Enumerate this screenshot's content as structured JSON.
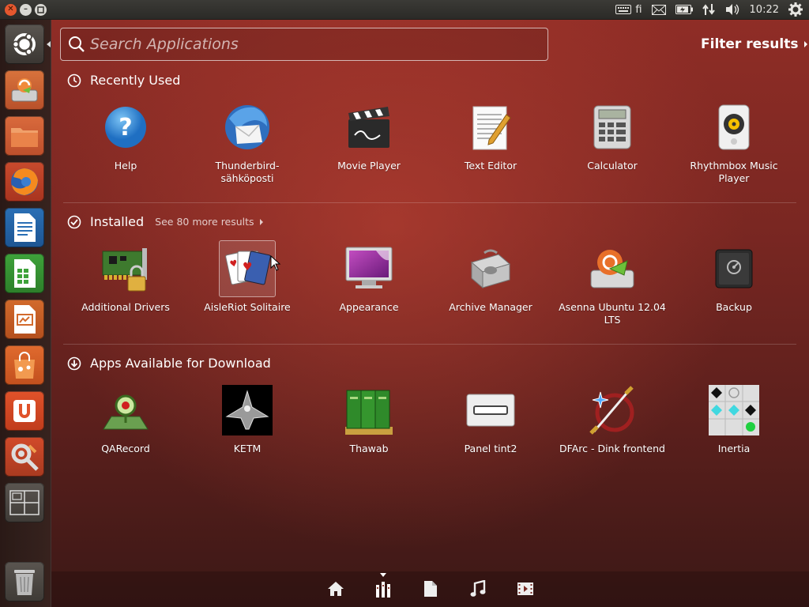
{
  "topbar": {
    "keyboard_layout": "fi",
    "clock": "10:22"
  },
  "search": {
    "placeholder": "Search Applications",
    "value": ""
  },
  "filter": {
    "label": "Filter results"
  },
  "sections": {
    "recent": {
      "title": "Recently Used",
      "apps": [
        {
          "label": "Help",
          "icon": "help-icon"
        },
        {
          "label": "Thunderbird-sähköposti",
          "icon": "thunderbird-icon"
        },
        {
          "label": "Movie Player",
          "icon": "movie-player-icon"
        },
        {
          "label": "Text Editor",
          "icon": "text-editor-icon"
        },
        {
          "label": "Calculator",
          "icon": "calculator-icon"
        },
        {
          "label": "Rhythmbox Music Player",
          "icon": "rhythmbox-icon"
        }
      ]
    },
    "installed": {
      "title": "Installed",
      "see_more": "See 80 more results",
      "apps": [
        {
          "label": "Additional Drivers",
          "icon": "drivers-icon"
        },
        {
          "label": "AisleRiot Solitaire",
          "icon": "solitaire-icon"
        },
        {
          "label": "Appearance",
          "icon": "appearance-icon"
        },
        {
          "label": "Archive Manager",
          "icon": "archive-manager-icon"
        },
        {
          "label": "Asenna Ubuntu 12.04 LTS",
          "icon": "install-ubuntu-icon"
        },
        {
          "label": "Backup",
          "icon": "backup-icon"
        }
      ]
    },
    "download": {
      "title": "Apps Available for Download",
      "apps": [
        {
          "label": "QARecord",
          "icon": "qarecord-icon"
        },
        {
          "label": "KETM",
          "icon": "ketm-icon"
        },
        {
          "label": "Thawab",
          "icon": "thawab-icon"
        },
        {
          "label": "Panel tint2",
          "icon": "tint2-icon"
        },
        {
          "label": "DFArc - Dink frontend",
          "icon": "dfarc-icon"
        },
        {
          "label": "Inertia",
          "icon": "inertia-icon"
        }
      ]
    }
  },
  "colors": {
    "dash_tint": "#8f2d26",
    "panel": "#3b3a36",
    "close_button": "#e4572e"
  }
}
